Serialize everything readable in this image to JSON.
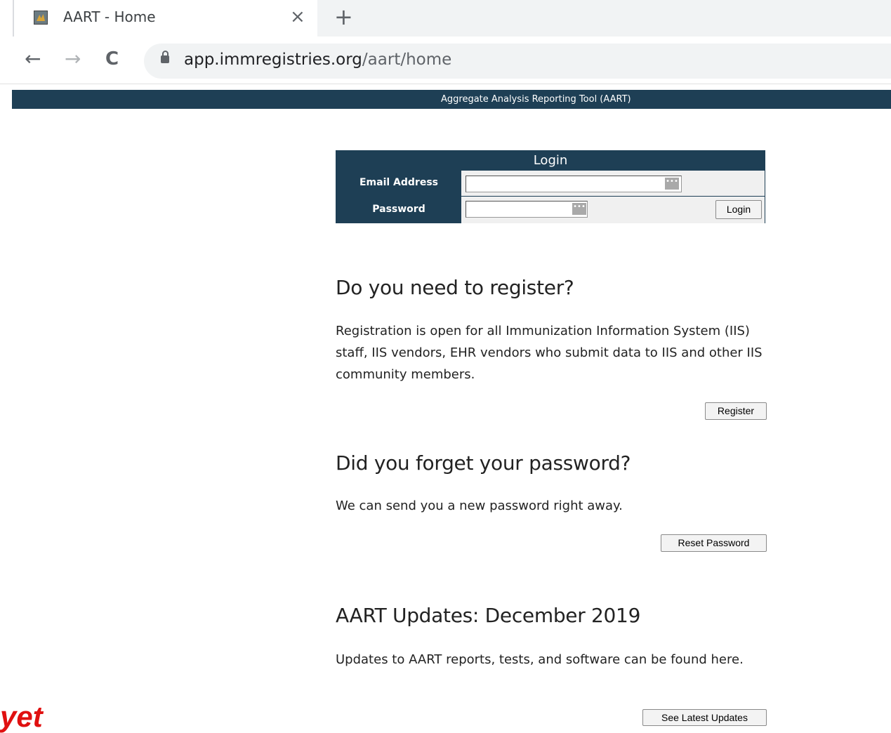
{
  "browser": {
    "tab_title": "AART - Home",
    "tab_close": "×",
    "new_tab": "+",
    "back": "←",
    "forward": "→",
    "reload": "C",
    "url_host": "app.immregistries.org",
    "url_path": "/aart/home"
  },
  "appbar": {
    "title": "Aggregate Analysis Reporting Tool (AART)"
  },
  "login": {
    "header": "Login",
    "email_label": "Email Address",
    "password_label": "Password",
    "email_value": "",
    "password_value": "",
    "login_button": "Login",
    "dots": "•••"
  },
  "sections": {
    "register": {
      "heading": "Do you need to register?",
      "text": "Registration is open for all Immunization Information System (IIS) staff, IIS vendors, EHR vendors who submit data to IIS and other IIS community members.",
      "button": "Register"
    },
    "forgot": {
      "heading": "Did you forget your password?",
      "text": "We can send you a new password right away.",
      "button": "Reset Password"
    },
    "updates": {
      "heading": "AART Updates: December 2019",
      "text": "Updates to AART reports, tests, and software can be found here.",
      "button": "See Latest Updates"
    }
  },
  "overlay_text": "yet"
}
